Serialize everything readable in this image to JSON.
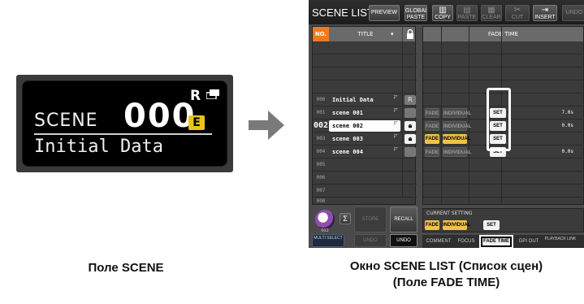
{
  "scene_field": {
    "label": "SCENE",
    "number": "000",
    "r_badge": "R",
    "e_badge": "E",
    "title": "Initial Data",
    "icons": [
      "window-icon"
    ]
  },
  "captions": {
    "left": "Поле SCENE",
    "right_line1": "Окно SCENE LIST (Список сцен)",
    "right_line2": "(Поле FADE TIME)"
  },
  "scene_list": {
    "title": "SCENE LIST",
    "toolbar": [
      {
        "label": "PREVIEW"
      },
      {
        "label": "GLOBAL PASTE"
      },
      {
        "label": "COPY"
      },
      {
        "label": "PASTE"
      },
      {
        "label": "CLEAR"
      },
      {
        "label": "CUT"
      },
      {
        "label": "INSERT"
      },
      {
        "label": "UNDO"
      }
    ],
    "columns": {
      "no": "NO.",
      "title": "TITLE",
      "fade_time": "FADE TIME"
    },
    "rows": [
      {
        "no": "000",
        "title": "Initial Data",
        "lock": "R"
      },
      {
        "no": "001",
        "title": "scene 001",
        "fade": "FADE",
        "individual": "INDIVIDUAL",
        "set": "SET",
        "time": "7.0s"
      },
      {
        "no": "002",
        "title": "scene 002",
        "fade": "FADE",
        "individual": "INDIVIDUAL",
        "set": "SET",
        "time": "0.0s"
      },
      {
        "no": "003",
        "title": "scene 003",
        "fade": "FADE",
        "individual": "INDIVIDUAL",
        "set": "SET"
      },
      {
        "no": "004",
        "title": "scene 004",
        "fade": "FADE",
        "individual": "INDIVIDUAL",
        "set": "SET",
        "time": "0.0s"
      },
      {
        "no": "005"
      },
      {
        "no": "006"
      },
      {
        "no": "007"
      },
      {
        "no": "008"
      }
    ],
    "current_number": "002",
    "knob_value": "002",
    "buttons": {
      "sigma": "Σ",
      "store": "STORE",
      "recall": "RECALL",
      "multi_select": "MULTI SELECT",
      "undo_dim": "UNDO",
      "undo": "UNDO"
    },
    "current_setting": {
      "label": "CURRENT SETTING",
      "fade": "FADE",
      "individual": "INDIVIDUAL",
      "set": "SET"
    },
    "tabs": [
      {
        "label": "COMMENT"
      },
      {
        "label": "FOCUS"
      },
      {
        "label": "FADE TIME"
      },
      {
        "label": "GPI OUT"
      },
      {
        "label": "PLAYBACK LINK"
      }
    ]
  }
}
